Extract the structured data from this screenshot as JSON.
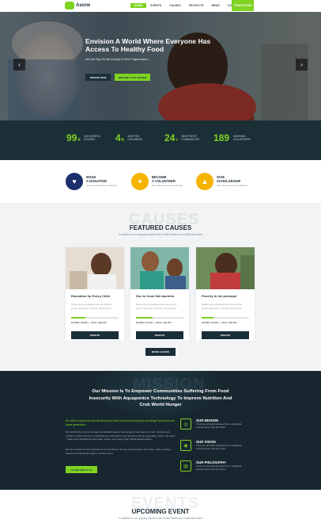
{
  "header": {
    "logo": "Asone",
    "nav": [
      "HOME",
      "EVENTS",
      "CAUSES",
      "PROJECTS",
      "NEWS",
      "CONTACT"
    ],
    "donate_button": "DONATE NOW"
  },
  "hero": {
    "title": "Envision A World Where Everyone Has Access To Healthy Food",
    "subtitle": "We Are Non-Profit Charity & NGO Organization.",
    "donate_button": "DONATE NOW",
    "volunteer_button": "BECOME A VOLUNTEER",
    "prev_arrow": "‹",
    "next_arrow": "›"
  },
  "stats": [
    {
      "num": "99",
      "suffix": "K",
      "label": "SUCCESSFUL STORIES"
    },
    {
      "num": "4",
      "suffix": "K",
      "label": "ADOPTED CHILDRENS"
    },
    {
      "num": "24",
      "suffix": "+",
      "label": "NEW PROFIT COMMUNITIES"
    },
    {
      "num": "189",
      "suffix": "",
      "label": "WORKING VOLUNTEERS"
    }
  ],
  "features": [
    {
      "title1": "MAKE",
      "title2": "A DONATION",
      "text": "Sed nisi donnard ea criticises",
      "icon": "donation-hand-icon",
      "color": "#1a2f6b"
    },
    {
      "title1": "BECOME",
      "title2": "A VOLUNTEER",
      "text": "Sed nisi donnard ea criticises",
      "icon": "volunteer-badge-icon",
      "color": "#f4b400"
    },
    {
      "title1": "GIVE",
      "title2": "SCHOLARSHIP",
      "text": "Sed nisi donnard ea criticises",
      "icon": "scholarship-cap-icon",
      "color": "#f4b400"
    }
  ],
  "causes": {
    "watermark": "CAUSES",
    "title": "FEATURED CAUSES",
    "subtitle": "In addition to our ongoing impact in the United States as a California based",
    "more_button": "MORE CAUSES",
    "cards": [
      {
        "title": "Education for Every Child",
        "text": "Neque porro quisquam est qui dolorem ipsum quia dolor sit amet, consectetur.",
        "raised": "RAISED: $5,890",
        "goal": "GOAL: $20,000",
        "progress": 0.3,
        "button": "DONATE"
      },
      {
        "title": "Due to fresh fish bacteria",
        "text": "Neque porro quisquam est qui dolorem ipsum quia dolor sit amet, consectetur.",
        "raised": "RAISED: $7,000",
        "goal": "GOAL: $20,000",
        "progress": 0.35,
        "button": "DONATE"
      },
      {
        "title": "Poverty is the principal",
        "text": "Neque porro quisquam est qui dolorem ipsum quia dolor sit amet, consectetur.",
        "raised": "RAISED: $4,890",
        "goal": "GOAL: $20,000",
        "progress": 0.25,
        "button": "DONATE"
      }
    ]
  },
  "mission": {
    "watermark": "MISSION",
    "title": "Our Mission Is To Empower Communities Suffering From Food Insecurity With Aquaponics Technology To Improve Nutrition And Crub World Hunger",
    "lead": "We utilize a long-term educational impact model focused on paving the knowledge forward across future generations.",
    "para1": "By constructing environmentally sustainable organic food systems that require no soil - families can produce a better harvest of pesticide-free and nutrient rich produce such as vegetables, fruits, and herbs - while using significantly less water, space, and energy than traditional agriculture.",
    "para2": "We are confident in the potential of our members in the key professionals. Our focus - there working experience effectively brings us achievement.",
    "button": "LEARN ABOUT US",
    "items": [
      {
        "title": "OUR MISSION",
        "text": "There are primarily designed from a traditional security desk to the first ranks.",
        "icon": "target-icon"
      },
      {
        "title": "OUR VISION",
        "text": "There are primarily designed from a traditional security desk to the first ranks.",
        "icon": "eye-icon"
      },
      {
        "title": "OUR PHILOSOPHY",
        "text": "There are primarily designed from a traditional security desk to the first ranks.",
        "icon": "book-icon"
      }
    ]
  },
  "events": {
    "watermark": "EVENTS",
    "title": "UPCOMING EVENT",
    "subtitle": "In addition to our ongoing impact in the United States as a California based"
  }
}
